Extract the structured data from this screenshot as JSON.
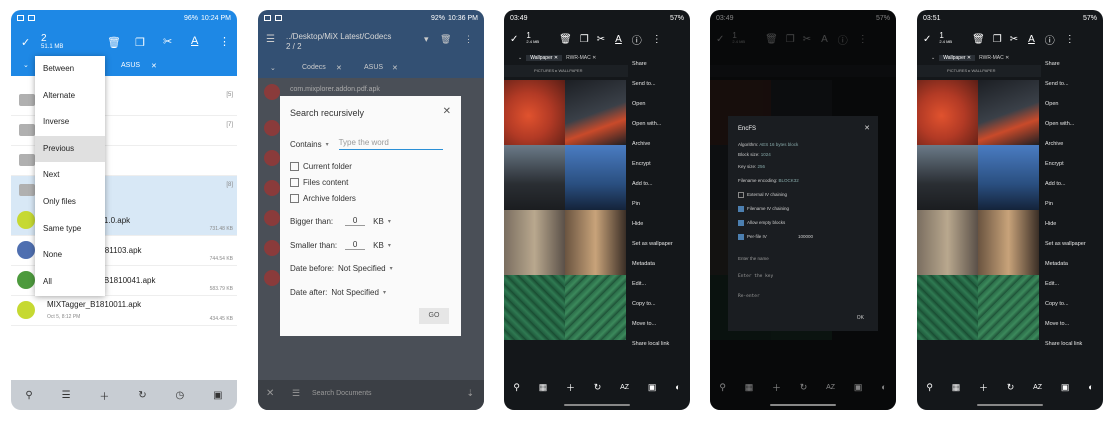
{
  "phone1": {
    "status": {
      "percent": "96%",
      "time": "10:24 PM"
    },
    "selection": {
      "count": "2",
      "size": "51.1 MB"
    },
    "tabs": [
      "ASUS"
    ],
    "menu": [
      "Between",
      "Alternate",
      "Inverse",
      "Previous",
      "Next",
      "Only files",
      "Same type",
      "None",
      "All"
    ],
    "highlighted": "Previous",
    "rows": [
      {
        "name": "",
        "date": "",
        "count": "[5]",
        "size": ""
      },
      {
        "name": "",
        "date": "",
        "count": "[7]",
        "size": ""
      },
      {
        "name": "",
        "date": "",
        "count": "",
        "size": ""
      },
      {
        "name": "",
        "date": "",
        "count": "[8]",
        "size": ""
      },
      {
        "name": "g_1.0.apk",
        "date": "",
        "count": "",
        "size": "731.48 KB"
      },
      {
        "name": "B181103.apk",
        "date": "",
        "count": "",
        "size": "744.54 KB"
      },
      {
        "name": "a_B1810041.apk",
        "date": "",
        "count": "",
        "size": "583.79 KB"
      },
      {
        "name": "MIXTagger_B1810011.apk",
        "date": "Oct 5, 8:12 PM",
        "count": "",
        "size": "434.45 KB"
      }
    ],
    "colors": {
      "accent": "#1e88e5"
    }
  },
  "phone2": {
    "status": {
      "percent": "92%",
      "time": "10:36 PM"
    },
    "path": {
      "line1": "../Desktop/MiX Latest/Codecs",
      "line2": "2 / 2"
    },
    "tabs": [
      "Codecs",
      "ASUS"
    ],
    "bg_file": "com.mixplorer.addon.pdf.apk",
    "dialog": {
      "title": "Search recursively",
      "contains_label": "Contains",
      "placeholder": "Type the word",
      "options": [
        "Current folder",
        "Files content",
        "Archive folders"
      ],
      "bigger_label": "Bigger than:",
      "bigger_value": "0",
      "bigger_unit": "KB",
      "smaller_label": "Smaller than:",
      "smaller_value": "0",
      "smaller_unit": "KB",
      "before_label": "Date before:",
      "before_value": "Not Specified",
      "after_label": "Date after:",
      "after_value": "Not Specified",
      "go": "GO"
    },
    "bottom_label": "Search Documents"
  },
  "phone3": {
    "status": {
      "percent": "57%",
      "time": "03:49"
    },
    "selection": {
      "count": "1",
      "size": "2.4 MB"
    },
    "tabs": [
      "Wallpaper",
      "RWR-MAC"
    ],
    "crumb": "PICTURES ▸ WALLPAPER",
    "menu": [
      "Share",
      "Send to...",
      "Open",
      "Open with...",
      "Archive",
      "Encrypt",
      "Add to...",
      "Pin",
      "Hide",
      "Set as wallpaper",
      "Metadata",
      "Edit...",
      "Copy to...",
      "Move to...",
      "Share local link"
    ]
  },
  "phone4": {
    "status": {
      "percent": "57%",
      "time": "03:49"
    },
    "selection": {
      "count": "1",
      "size": "2.4 MB"
    },
    "dialog": {
      "title": "EncFS",
      "algorithm_label": "Algorithm:",
      "algorithm_value": "AES 16 bytes block",
      "block_label": "Block size:",
      "block_value": "1024",
      "key_label": "Key size:",
      "key_value": "256",
      "fne_label": "Filename encoding:",
      "fne_value": "BLOCK32",
      "checks": [
        "External IV chaining",
        "Filename IV chaining",
        "Allow empty blocks",
        "Per-file IV"
      ],
      "mode_value": "100000",
      "enter_name": "Enter the name",
      "enter_key": "Enter the key",
      "reenter": "Re-enter",
      "ok": "OK"
    }
  },
  "phone5": {
    "status": {
      "percent": "57%",
      "time": "03:51"
    },
    "selection": {
      "count": "1",
      "size": "2.4 MB"
    },
    "tabs": [
      "Wallpaper",
      "RWR-MAC"
    ],
    "crumb": "PICTURES ▸ WALLPAPER",
    "menu": [
      "Share",
      "Send to...",
      "Open",
      "Open with...",
      "Archive",
      "Encrypt",
      "Add to...",
      "Pin",
      "Hide",
      "Set as wallpaper",
      "Metadata",
      "Edit...",
      "Copy to...",
      "Move to...",
      "Share local link"
    ]
  },
  "wallpaper_colors": [
    "#c2442a",
    "#3a3f47",
    "#2e5a7c",
    "#5a7fb5",
    "#6f6a62",
    "#6a5a4a",
    "#2f6a4c",
    "#3b7a56"
  ]
}
